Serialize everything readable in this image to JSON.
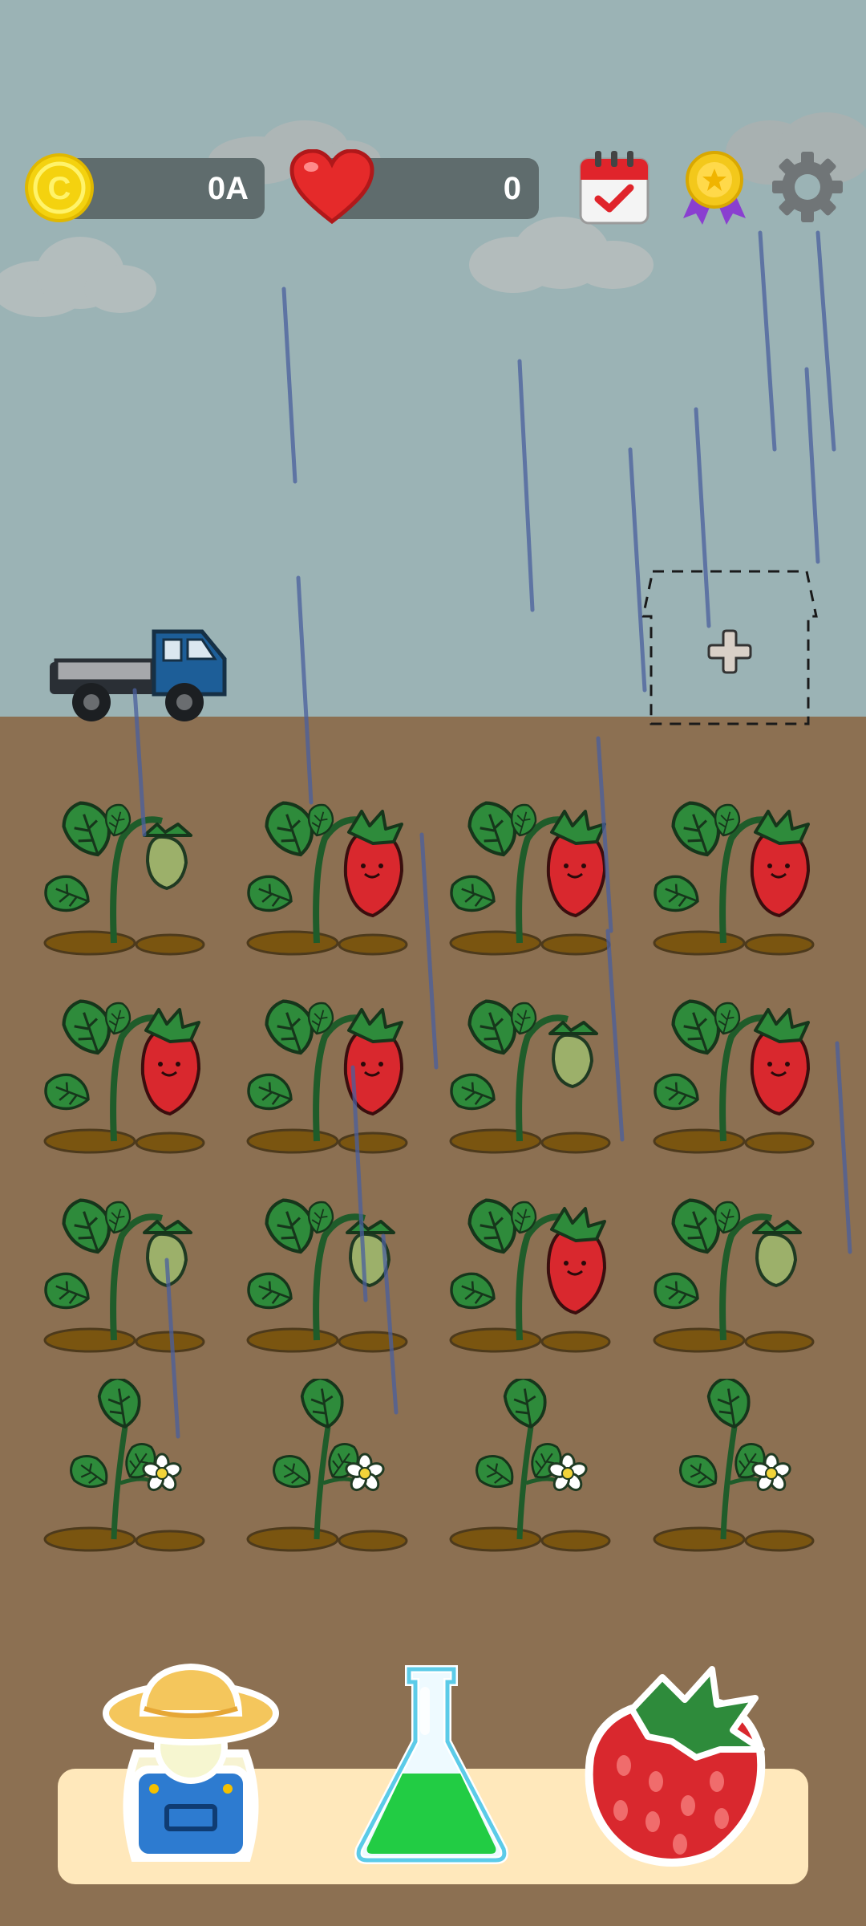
{
  "hud": {
    "coins_value": "0A",
    "hearts_value": "0",
    "coin_icon": "coin-icon",
    "heart_icon": "heart-icon",
    "buttons": [
      "calendar-icon",
      "medal-icon",
      "gear-icon"
    ]
  },
  "field": {
    "vehicle": "delivery-truck",
    "add_slot": "plus-icon",
    "rows": [
      [
        "unripe",
        "ripe",
        "ripe",
        "ripe"
      ],
      [
        "ripe",
        "ripe",
        "unripe",
        "ripe"
      ],
      [
        "unripe",
        "unripe",
        "ripe",
        "unripe"
      ],
      [
        "flower",
        "flower",
        "flower",
        "flower"
      ]
    ]
  },
  "toolbar": {
    "items": [
      "farmer",
      "potion-flask",
      "strawberry"
    ]
  },
  "colors": {
    "sky": "#9bb3b5",
    "soil": "#8c7052",
    "hud_pill": "#5f6c6d",
    "panel": "#ffe8bb",
    "strawberry_red": "#d9282e",
    "leaf_green": "#2e8b3b"
  }
}
